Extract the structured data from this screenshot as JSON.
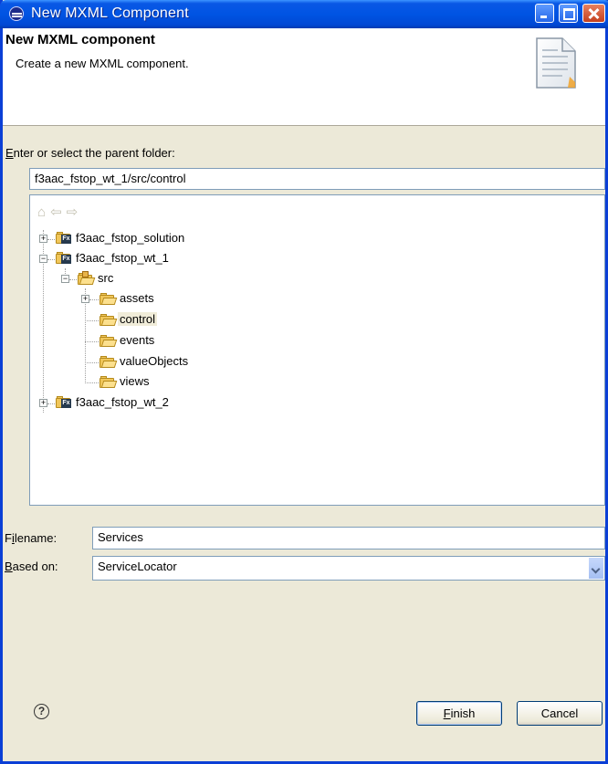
{
  "window": {
    "title": "New MXML Component"
  },
  "banner": {
    "title": "New MXML component",
    "description": "Create a new MXML component.",
    "icon": "document-icon"
  },
  "parent_folder": {
    "label_access_key": "E",
    "label_rest": "nter or select the parent folder:",
    "value": "f3aac_fstop_wt_1/src/control"
  },
  "tree": {
    "nav_icons": [
      "home-icon",
      "back-arrow-icon",
      "forward-arrow-icon"
    ],
    "nodes": [
      {
        "label": "f3aac_fstop_solution",
        "type": "flex-project",
        "expanded": false
      },
      {
        "label": "f3aac_fstop_wt_1",
        "type": "flex-project",
        "expanded": true
      },
      {
        "label": "src",
        "type": "source-folder",
        "expanded": true
      },
      {
        "label": "assets",
        "type": "folder",
        "expanded": false
      },
      {
        "label": "control",
        "type": "folder",
        "selected": true
      },
      {
        "label": "events",
        "type": "folder"
      },
      {
        "label": "valueObjects",
        "type": "folder"
      },
      {
        "label": "views",
        "type": "folder"
      },
      {
        "label": "f3aac_fstop_wt_2",
        "type": "flex-project",
        "expanded": false
      }
    ]
  },
  "filename": {
    "label_access_key": "i",
    "label_pre": "F",
    "label_rest": "lename:",
    "value": "Services"
  },
  "based_on": {
    "label_access_key": "B",
    "label_rest": "ased on:",
    "value": "ServiceLocator"
  },
  "buttons": {
    "finish_access_key": "F",
    "finish_rest": "inish",
    "cancel": "Cancel"
  },
  "colors": {
    "titlebar": "#0054e3",
    "dialog_bg": "#ece9d8",
    "field_border": "#7f9db9"
  }
}
